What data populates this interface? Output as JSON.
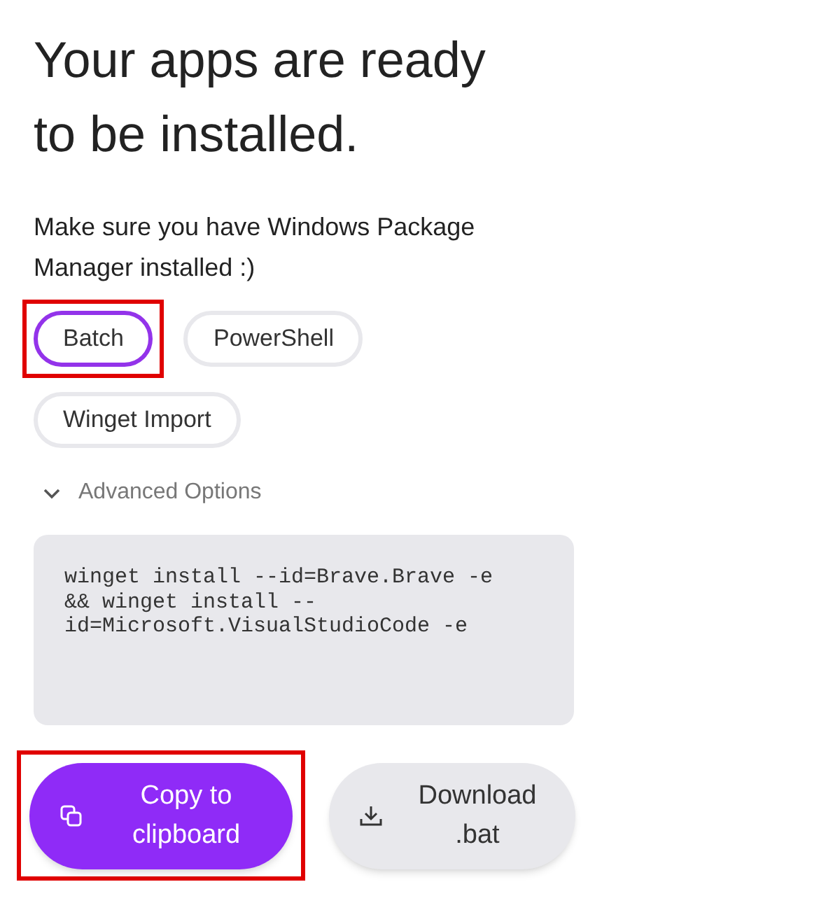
{
  "heading": "Your apps are ready to be installed.",
  "note": "Make sure you have Windows Package Manager installed :)",
  "tabs": [
    {
      "label": "Batch",
      "selected": true,
      "highlighted": true
    },
    {
      "label": "PowerShell",
      "selected": false,
      "highlighted": false
    },
    {
      "label": "Winget Import",
      "selected": false,
      "highlighted": false
    }
  ],
  "advanced_options": {
    "label": "Advanced Options",
    "expanded": false
  },
  "command_lines": [
    "winget install --id=Brave.Brave -e",
    "&& winget install --",
    "id=Microsoft.VisualStudioCode -e"
  ],
  "buttons": [
    {
      "kind": "copy",
      "label": "Copy to clipboard",
      "highlighted": true
    },
    {
      "kind": "download",
      "label": "Download .bat",
      "highlighted": false
    }
  ]
}
